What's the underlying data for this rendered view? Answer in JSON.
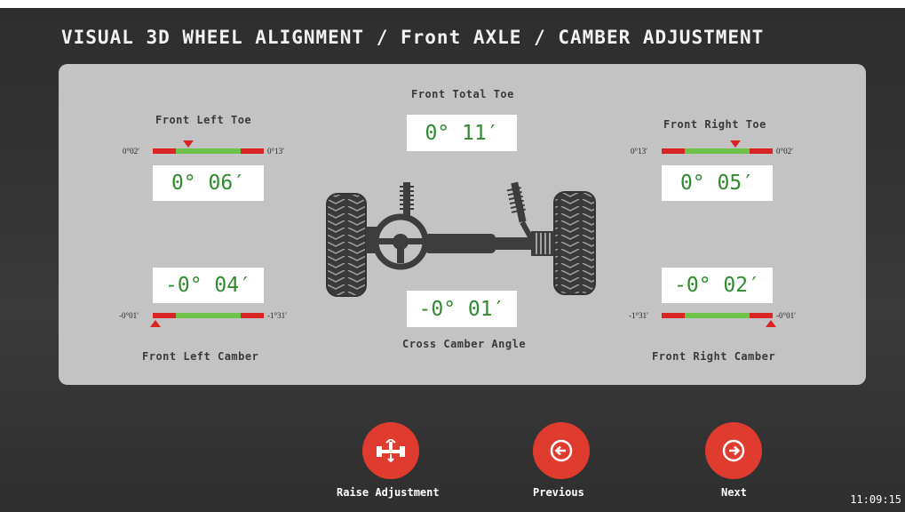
{
  "header": {
    "title": "VISUAL 3D WHEEL ALIGNMENT / Front AXLE / CAMBER ADJUSTMENT"
  },
  "center": {
    "total_toe_label": "Front Total Toe",
    "total_toe_value": "0° 11′",
    "cross_camber_label": "Cross Camber Angle",
    "cross_camber_value": "-0° 01′"
  },
  "left": {
    "toe_label": "Front Left Toe",
    "toe_value": "0° 06′",
    "toe_min": "0°02′",
    "toe_max": "0°13′",
    "toe_position": 0.32,
    "camber_label": "Front Left Camber",
    "camber_value": "-0° 04′",
    "camber_min": "-0°01′",
    "camber_max": "-1°31′",
    "camber_position": 0.02
  },
  "right": {
    "toe_label": "Front Right Toe",
    "toe_value": "0° 05′",
    "toe_min": "0°13′",
    "toe_max": "0°02′",
    "toe_position": 0.66,
    "camber_label": "Front Right Camber",
    "camber_value": "-0° 02′",
    "camber_min": "-1°31′",
    "camber_max": "-0°01′",
    "camber_position": 0.98
  },
  "buttons": {
    "raise": {
      "label": "Raise Adjustment",
      "icon": "raise-lift-icon"
    },
    "previous": {
      "label": "Previous",
      "icon": "arrow-left-circle-icon"
    },
    "next": {
      "label": "Next",
      "icon": "arrow-right-circle-icon"
    }
  },
  "status": {
    "clock": "11:09:15"
  },
  "colors": {
    "accent": "#e03b2f",
    "in_range": "#6ec24a",
    "out_of_range": "#d82424",
    "value_text": "#2e8b2e"
  }
}
